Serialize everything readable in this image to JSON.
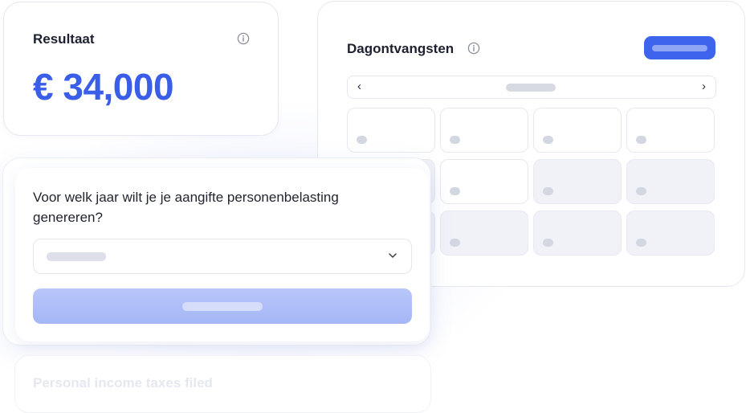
{
  "result": {
    "title": "Resultaat",
    "value": "€ 34,000"
  },
  "calendar": {
    "title": "Dagontvangsten",
    "prev_label": "‹",
    "next_label": "›",
    "cells": [
      {
        "state": "normal"
      },
      {
        "state": "normal"
      },
      {
        "state": "normal"
      },
      {
        "state": "normal"
      },
      {
        "state": "dim"
      },
      {
        "state": "normal"
      },
      {
        "state": "dim"
      },
      {
        "state": "dim"
      },
      {
        "state": "dim"
      },
      {
        "state": "dim"
      },
      {
        "state": "dim"
      },
      {
        "state": "dim"
      }
    ]
  },
  "question": {
    "text": "Voor welk jaar wilt je je aangifte personenbelasting genereren?"
  },
  "faded_card": {
    "text": "Personal income taxes filed"
  },
  "colors": {
    "accent": "#3a5ee8",
    "button_primary": "#3e63ec",
    "button_disabled": "#a5b6f6"
  },
  "icons": {
    "info": "info-icon",
    "chevron_down": "chevron-down-icon"
  }
}
